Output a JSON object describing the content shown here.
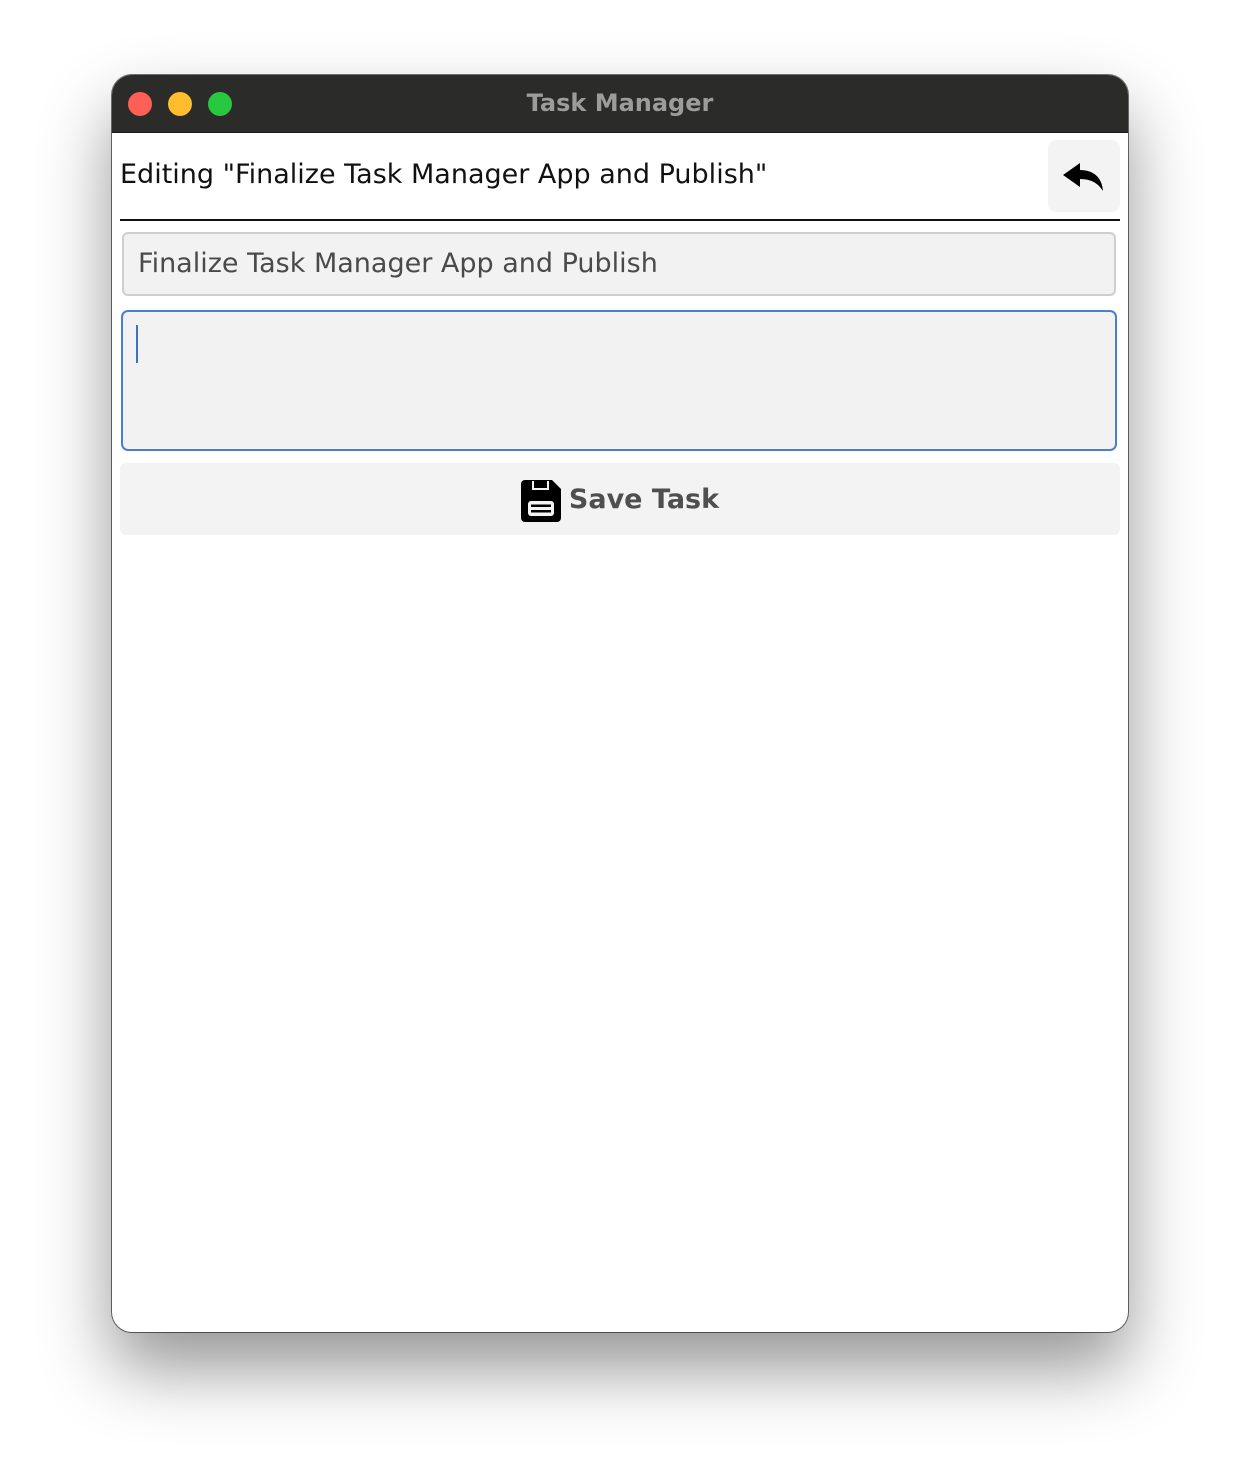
{
  "window": {
    "title": "Task Manager"
  },
  "header": {
    "heading": "Editing \"Finalize Task Manager App and Publish\"",
    "back_icon": "reply-arrow-icon"
  },
  "form": {
    "title_value": "Finalize Task Manager App and Publish",
    "description_value": "",
    "save_label": "Save Task",
    "save_icon": "floppy-disk-icon"
  },
  "colors": {
    "titlebar": "#2b2b29",
    "focus_border": "#4a7fd0",
    "close": "#fe5f57",
    "minimize": "#febc2e",
    "zoom": "#28c840"
  }
}
